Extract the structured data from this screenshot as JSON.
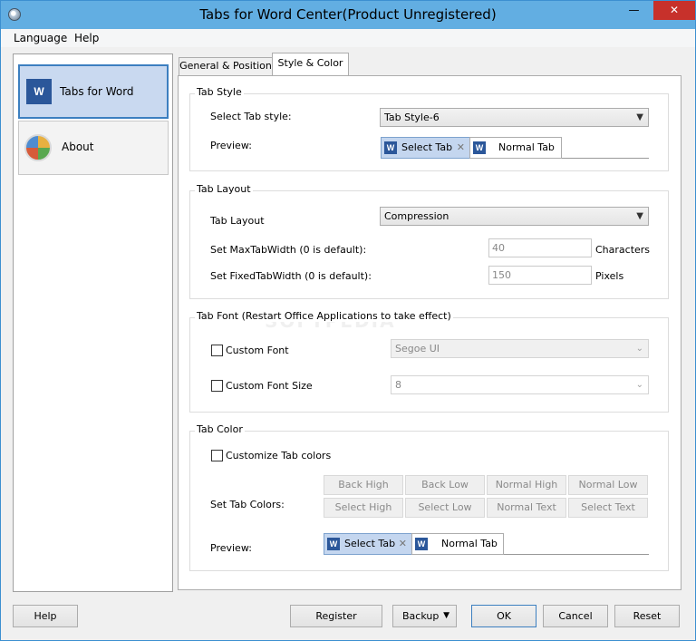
{
  "window": {
    "title": "Tabs for Word Center(Product Unregistered)"
  },
  "menu": {
    "items": [
      "Language",
      "Help"
    ]
  },
  "sidebar": {
    "items": [
      {
        "label": "Tabs for Word",
        "icon": "word-icon"
      },
      {
        "label": "About",
        "icon": "about-icon"
      }
    ]
  },
  "tabs": [
    "General & Position",
    "Style & Color"
  ],
  "tab_style": {
    "title": "Tab Style",
    "select_label": "Select Tab style:",
    "select_value": "Tab Style-6",
    "preview_label": "Preview:",
    "preview_selected": "Select Tab",
    "preview_normal": "Normal Tab"
  },
  "tab_layout": {
    "title": "Tab Layout",
    "layout_label": "Tab Layout",
    "layout_value": "Compression",
    "max_width_label": "Set MaxTabWidth (0 is default):",
    "max_width_value": "40",
    "max_width_unit": "Characters",
    "fixed_width_label": "Set FixedTabWidth (0 is default):",
    "fixed_width_value": "150",
    "fixed_width_unit": "Pixels"
  },
  "tab_font": {
    "title": "Tab Font (Restart Office Applications to take effect)",
    "custom_font_label": "Custom Font",
    "font_value": "Segoe UI",
    "custom_size_label": "Custom Font Size",
    "size_value": "8"
  },
  "tab_color": {
    "title": "Tab Color",
    "customize_label": "Customize Tab colors",
    "set_colors_label": "Set Tab Colors:",
    "buttons_row1": [
      "Back High",
      "Back Low",
      "Normal High",
      "Normal Low"
    ],
    "buttons_row2": [
      "Select High",
      "Select Low",
      "Normal Text",
      "Select Text"
    ],
    "preview_label": "Preview:",
    "preview_selected": "Select Tab",
    "preview_normal": "Normal Tab"
  },
  "footer": {
    "help": "Help",
    "register": "Register",
    "backup": "Backup",
    "ok": "OK",
    "cancel": "Cancel",
    "reset": "Reset"
  },
  "watermark": "SOFTPEDIA",
  "colors": {
    "titlebar": "#62aee2",
    "close_button": "#c7312b",
    "selected_tab": "#c4d6ef",
    "word_blue": "#2b579a"
  }
}
